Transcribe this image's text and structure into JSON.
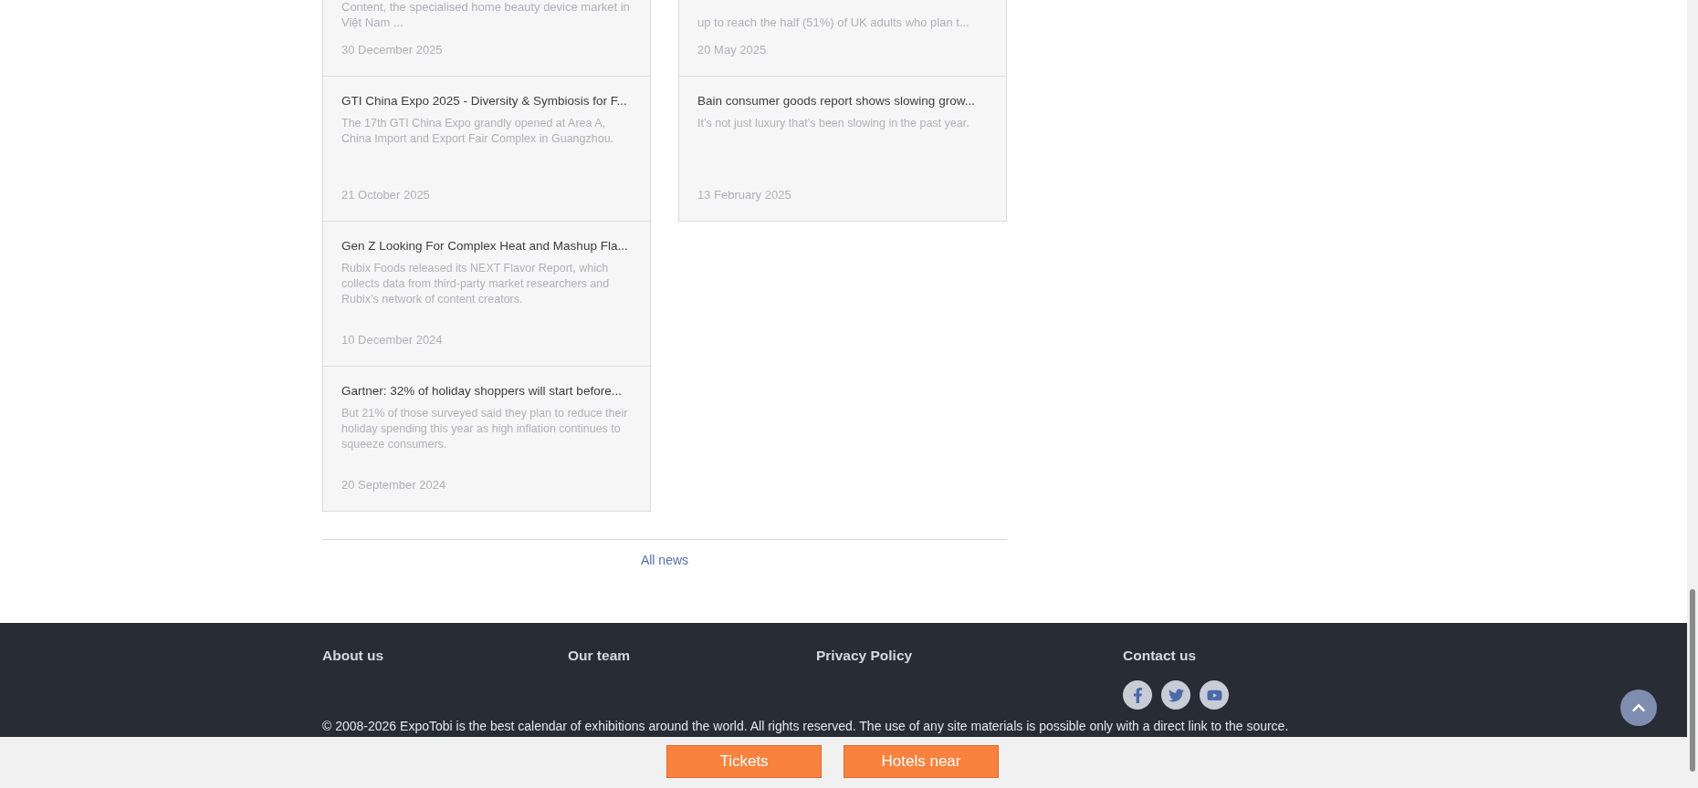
{
  "news_columns": [
    {
      "cards": [
        {
          "description": "Content, the specialised home beauty device market in Việt Nam ...",
          "date": "30 December 2025"
        },
        {
          "title": "GTI China Expo 2025 - Diversity & Symbiosis for F...",
          "description": "The 17th GTI China Expo grandly opened at Area A, China Import and Export Fair Complex in Guangzhou.",
          "date": "21 October 2025"
        },
        {
          "title": "Gen Z Looking For Complex Heat and Mashup Fla...",
          "description": "Rubix Foods released its NEXT Flavor Report, which collects data from third-party market researchers and Rubix’s network of content creators.",
          "date": "10 December 2024"
        },
        {
          "title": "Gartner: 32% of holiday shoppers will start before...",
          "description": "But 21% of those surveyed said they plan to reduce their holiday spending this year as high inflation continues to squeeze consumers.",
          "date": "20 September 2024"
        }
      ]
    },
    {
      "cards": [
        {
          "description": "up to reach the half (51%) of UK adults who plan t...",
          "date": "20 May 2025"
        },
        {
          "title": "Bain consumer goods report shows slowing grow...",
          "description": "It’s not just luxury that’s been slowing in the past year.",
          "date": "13 February 2025"
        }
      ]
    }
  ],
  "all_news_link": "All news",
  "footer": {
    "links": [
      "About us",
      "Our team",
      "Privacy Policy"
    ],
    "contact_heading": "Contact us",
    "socials": [
      {
        "kind": "facebook"
      },
      {
        "kind": "twitter"
      },
      {
        "kind": "youtube"
      }
    ],
    "copyright": "© 2008-2026 ExpoTobi is the best calendar of exhibitions around the world. All rights reserved. The use of any site materials is possible only with a direct link to the source."
  },
  "bottom_bar": {
    "buttons": [
      "Tickets",
      "Hotels near"
    ]
  }
}
